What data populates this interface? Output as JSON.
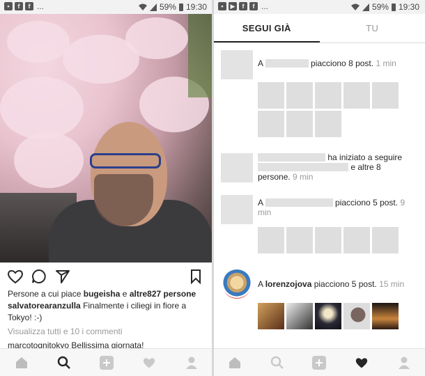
{
  "left": {
    "status": {
      "battery": "59%",
      "time": "19:30",
      "overflow": "..."
    },
    "post": {
      "likes_prefix": "Persone a cui piace",
      "liker1": "bugeisha",
      "conj": "e",
      "likes_others": "altre827 persone",
      "author": "salvatorearanzulla",
      "caption": "Finalmente i ciliegi in fiore a Tokyo! :-)",
      "view_comments": "Visualizza tutti e 10 i commenti",
      "comment_user": "marcotognitokyo",
      "comment_text": "Bellissima giornata!"
    }
  },
  "right": {
    "status": {
      "battery": "59%",
      "time": "19:30",
      "overflow": "..."
    },
    "tabs": [
      {
        "label": "SEGUI GIÀ",
        "active": true
      },
      {
        "label": "TU",
        "active": false
      }
    ],
    "activities": [
      {
        "prefix": "A",
        "text": "piacciono 8 post.",
        "time": "1 min"
      },
      {
        "text": "ha iniziato a seguire",
        "text2": "e altre 8",
        "text3": "persone.",
        "time": "9 min"
      },
      {
        "prefix": "A",
        "text": "piacciono 5 post.",
        "time": "9 min"
      },
      {
        "prefix": "A",
        "user": "lorenzojova",
        "text": "piacciono 5 post.",
        "time": "15 min"
      }
    ]
  },
  "nav_icons": [
    "home-icon",
    "search-icon",
    "add-icon",
    "heart-icon",
    "profile-icon"
  ],
  "colors": {
    "accent": "#262626",
    "muted": "#999999",
    "placeholder": "#e1e1e1"
  }
}
